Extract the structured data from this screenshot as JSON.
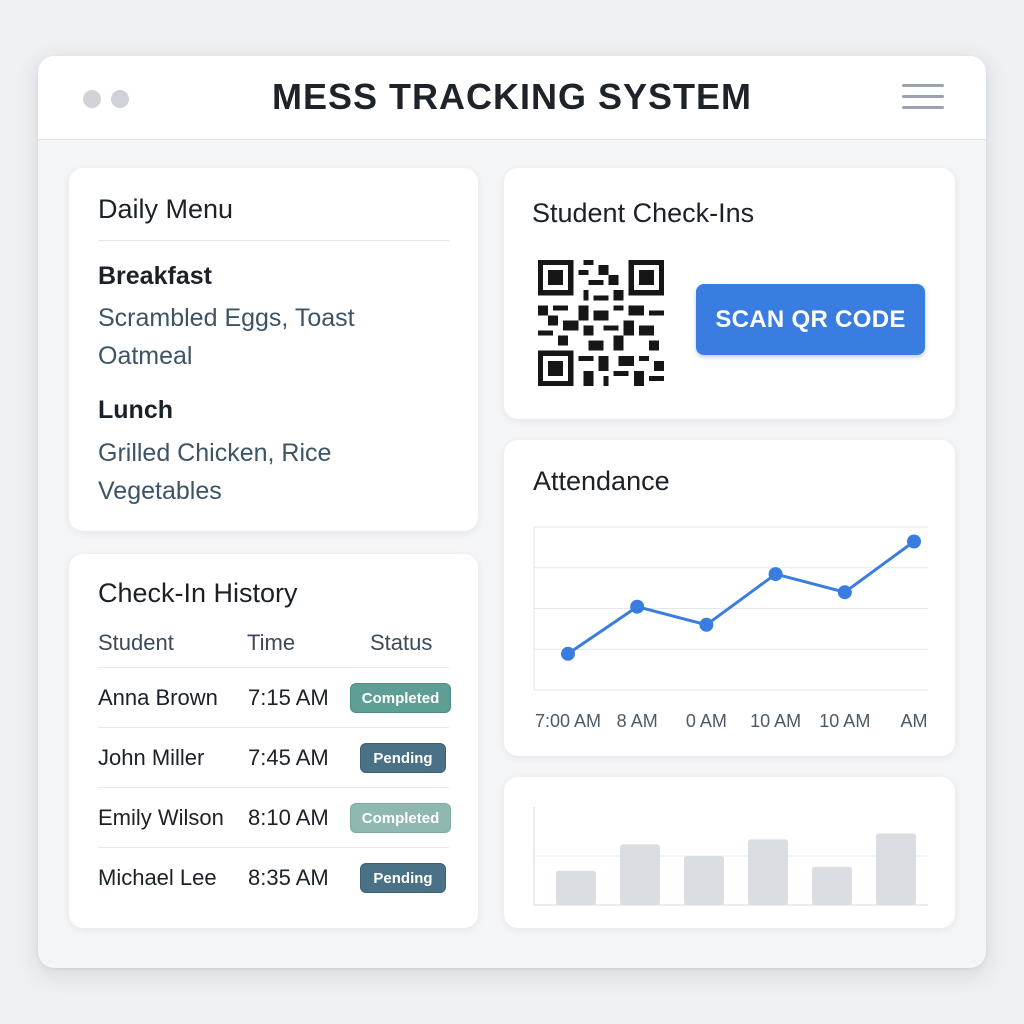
{
  "app": {
    "title": "MESS TRACKING SYSTEM"
  },
  "daily_menu": {
    "title": "Daily Menu",
    "meals": [
      {
        "name": "Breakfast",
        "items": [
          "Scrambled Eggs, Toast",
          "Oatmeal"
        ]
      },
      {
        "name": "Lunch",
        "items": [
          "Grilled Chicken, Rice",
          "Vegetables"
        ]
      }
    ]
  },
  "history": {
    "title": "Check-In History",
    "columns": [
      "Student",
      "Time",
      "Status"
    ],
    "rows": [
      {
        "student": "Anna Brown",
        "time": "7:15 AM",
        "status": "Completed"
      },
      {
        "student": "John Miller",
        "time": "7:45 AM",
        "status": "Pending"
      },
      {
        "student": "Emily Wilson",
        "time": "8:10 AM",
        "status": "Completed"
      },
      {
        "student": "Michael Lee",
        "time": "8:35 AM",
        "status": "Pending"
      }
    ]
  },
  "checkins": {
    "title": "Student Check-Ins",
    "scan_button": "SCAN QR CODE",
    "qr_icon": "qr-code-icon"
  },
  "colors": {
    "accent": "#3a7de0",
    "completed": "#5e9e95",
    "pending": "#4a7185",
    "bar": "#dadde1"
  },
  "chart_data": [
    {
      "type": "line",
      "title": "Attendance",
      "x": [
        "7:00 AM",
        "8 AM",
        "0 AM",
        "10 AM",
        "10 AM",
        "AM"
      ],
      "series": [
        {
          "values": [
            1,
            2.3,
            1.8,
            3.2,
            2.7,
            4.1
          ]
        }
      ],
      "ylim": [
        0,
        4.5
      ],
      "grid": true,
      "color": "#3a7de0"
    },
    {
      "type": "bar",
      "title": "",
      "categories": [
        "",
        "",
        "",
        "",
        "",
        ""
      ],
      "values": [
        3.5,
        6.2,
        5.0,
        6.7,
        3.9,
        7.3
      ],
      "ylim": [
        0,
        10
      ],
      "grid": true,
      "color": "#dadde1"
    }
  ]
}
